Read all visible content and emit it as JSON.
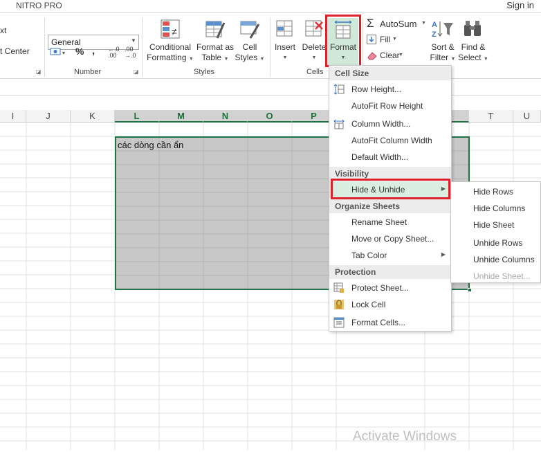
{
  "top": {
    "tab": "NITRO PRO",
    "signin": "Sign in"
  },
  "ribbon": {
    "alignment": {
      "wrap_text_fragment": "xt",
      "merge_center_fragment": "t Center"
    },
    "number": {
      "format_value": "General",
      "currency_symbol": "$",
      "percent": "%",
      "comma": ",",
      "inc_decimal": "←.0 .00",
      "dec_decimal": ".00 →.0",
      "group_label": "Number"
    },
    "styles": {
      "conditional_formatting": [
        "Conditional",
        "Formatting"
      ],
      "format_as_table": [
        "Format as",
        "Table"
      ],
      "cell_styles": [
        "Cell",
        "Styles"
      ],
      "group_label": "Styles"
    },
    "cells": {
      "insert": "Insert",
      "delete": "Delete",
      "format": "Format",
      "group_label": "Cells"
    },
    "editing": {
      "autosum": "AutoSum",
      "fill": "Fill",
      "clear": "Clear",
      "sort_filter": [
        "Sort &",
        "Filter"
      ],
      "find_select": [
        "Find &",
        "Select"
      ]
    }
  },
  "grid": {
    "columns": [
      "I",
      "J",
      "K",
      "L",
      "M",
      "N",
      "O",
      "P",
      "T",
      "U"
    ],
    "cell_text": "các dòng cần ẩn"
  },
  "menu": {
    "sections": {
      "cell_size": "Cell Size",
      "visibility": "Visibility",
      "organize": "Organize Sheets",
      "protection": "Protection"
    },
    "items": {
      "row_height": "Row Height...",
      "autofit_row": "AutoFit Row Height",
      "column_width": "Column Width...",
      "autofit_column": "AutoFit Column Width",
      "default_width": "Default Width...",
      "hide_unhide": "Hide & Unhide",
      "rename_sheet": "Rename Sheet",
      "move_copy": "Move or Copy Sheet...",
      "tab_color": "Tab Color",
      "protect_sheet": "Protect Sheet...",
      "lock_cell": "Lock Cell",
      "format_cells": "Format Cells..."
    }
  },
  "submenu": {
    "hide_rows": "Hide Rows",
    "hide_columns": "Hide Columns",
    "hide_sheet": "Hide Sheet",
    "unhide_rows": "Unhide Rows",
    "unhide_columns": "Unhide Columns",
    "unhide_sheet": "Unhide Sheet..."
  },
  "watermark": "Activate Windows",
  "colors": {
    "excel_green": "#217346",
    "highlight_red": "#e0202a",
    "selection_fill": "#c8c8c8",
    "menu_hover": "#d9eee0"
  }
}
